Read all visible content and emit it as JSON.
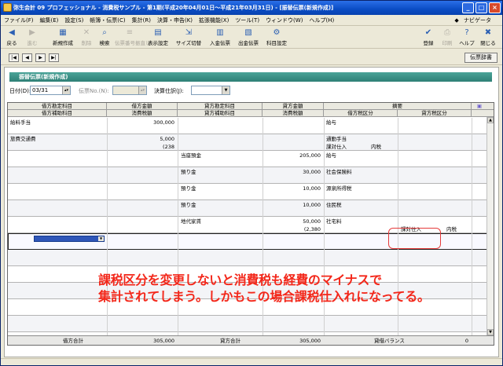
{
  "window": {
    "title": "弥生会計 09 プロフェッショナル - 消費税サンプル - 第1期(平成20年04月01日～平成21年03月31日) - [振替伝票(新規作成)]",
    "buttons": [
      "_",
      "□",
      "×"
    ]
  },
  "menu": {
    "items": [
      "ファイル(F)",
      "編集(E)",
      "設定(S)",
      "帳簿・伝票(C)",
      "集計(R)",
      "決算・申告(K)",
      "拡張機能(X)",
      "ツール(T)",
      "ウィンドウ(W)",
      "ヘルプ(H)"
    ],
    "navi_label": "ナビゲータ"
  },
  "toolbar": {
    "left": [
      {
        "label": "戻る",
        "icon": "back-arrow-icon",
        "enabled": true
      },
      {
        "label": "進む",
        "icon": "forward-arrow-icon",
        "enabled": false
      },
      {
        "label": "新規作成",
        "icon": "new-document-icon",
        "enabled": true
      },
      {
        "label": "削除",
        "icon": "delete-icon",
        "enabled": false
      },
      {
        "label": "検索",
        "icon": "search-icon",
        "enabled": true
      },
      {
        "label": "伝票番号振直し",
        "icon": "renumber-icon",
        "enabled": false
      },
      {
        "label": "表示設定",
        "icon": "display-settings-icon",
        "enabled": true
      },
      {
        "label": "サイズ切替",
        "icon": "resize-icon",
        "enabled": true
      },
      {
        "label": "入金伝票",
        "icon": "receipt-voucher-icon",
        "enabled": true
      },
      {
        "label": "出金伝票",
        "icon": "payment-voucher-icon",
        "enabled": true
      },
      {
        "label": "科目設定",
        "icon": "account-settings-icon",
        "enabled": true
      }
    ],
    "right": [
      {
        "label": "登録",
        "icon": "register-icon",
        "enabled": true
      },
      {
        "label": "印刷",
        "icon": "print-icon",
        "enabled": false
      },
      {
        "label": "ヘルプ",
        "icon": "help-icon",
        "enabled": true
      },
      {
        "label": "閉じる",
        "icon": "close-icon",
        "enabled": true
      }
    ]
  },
  "navigation": {
    "buttons": [
      "|◀",
      "◀",
      "▶",
      "▶|"
    ],
    "tanka_button": "伝票辞書"
  },
  "voucher": {
    "section_title": "振替伝票(新規作成)",
    "date_label": "日付(D):",
    "date_value": "03/31",
    "voucher_no_label": "伝票No.(N):",
    "voucher_no_value": "",
    "settlement_label": "決算仕訳(J):",
    "settlement_value": ""
  },
  "grid": {
    "header_top": [
      "借方勘定科目",
      "借方金額",
      "貸方勘定科目",
      "貸方金額",
      "摘要"
    ],
    "header_bottom": [
      "借方補助科目",
      "消費税額",
      "貸方補助科目",
      "消費税額",
      "借方税区分",
      "貸方税区分"
    ],
    "rows": [
      {
        "dr_account": "給料手当",
        "dr_amount": "300,000",
        "cr_account": "",
        "cr_amount": "",
        "memo": "給与",
        "dr_tax_type": "",
        "dr_tax_mode": "",
        "cr_tax_type": "",
        "cr_tax_mode": "",
        "dr_tax": "",
        "cr_tax": ""
      },
      {
        "dr_account": "旅費交通費",
        "dr_amount": "5,000",
        "dr_tax": "(238",
        "cr_account": "",
        "cr_amount": "",
        "cr_tax": "",
        "memo": "通勤手当",
        "dr_tax_type": "課対仕入",
        "dr_tax_mode": "内税",
        "cr_tax_type": "",
        "cr_tax_mode": ""
      },
      {
        "dr_account": "",
        "dr_amount": "",
        "dr_tax": "",
        "cr_account": "当座預金",
        "cr_amount": "205,000",
        "cr_tax": "",
        "memo": "給与",
        "dr_tax_type": "",
        "dr_tax_mode": "",
        "cr_tax_type": "",
        "cr_tax_mode": ""
      },
      {
        "dr_account": "",
        "dr_amount": "",
        "dr_tax": "",
        "cr_account": "預り金",
        "cr_amount": "30,000",
        "cr_tax": "",
        "memo": "社会保険料",
        "dr_tax_type": "",
        "dr_tax_mode": "",
        "cr_tax_type": "",
        "cr_tax_mode": ""
      },
      {
        "dr_account": "",
        "dr_amount": "",
        "dr_tax": "",
        "cr_account": "預り金",
        "cr_amount": "10,000",
        "cr_tax": "",
        "memo": "源泉所得税",
        "dr_tax_type": "",
        "dr_tax_mode": "",
        "cr_tax_type": "",
        "cr_tax_mode": ""
      },
      {
        "dr_account": "",
        "dr_amount": "",
        "dr_tax": "",
        "cr_account": "預り金",
        "cr_amount": "10,000",
        "cr_tax": "",
        "memo": "住民税",
        "dr_tax_type": "",
        "dr_tax_mode": "",
        "cr_tax_type": "",
        "cr_tax_mode": ""
      },
      {
        "dr_account": "",
        "dr_amount": "",
        "dr_tax": "",
        "cr_account": "地代家賃",
        "cr_amount": "50,000",
        "cr_tax": "(2,380",
        "memo": "社宅料",
        "dr_tax_type": "",
        "dr_tax_mode": "",
        "cr_tax_type": "課対仕入",
        "cr_tax_mode": "内税"
      }
    ],
    "footer": {
      "dr_total_label": "借方合計",
      "dr_total": "305,000",
      "cr_total_label": "貸方合計",
      "cr_total": "305,000",
      "balance_label": "貸借バランス",
      "balance": "0"
    }
  },
  "annotation": {
    "line1": "課税区分を変更しないと消費税も経費のマイナスで",
    "line2": "集計されてしまう。しかもこの場合課税仕入れになってる。",
    "color": "#f3271a"
  },
  "colors": {
    "title_bar": "#0a4cc4",
    "section_header": "#3a8f85",
    "selection": "#2f56b8"
  }
}
